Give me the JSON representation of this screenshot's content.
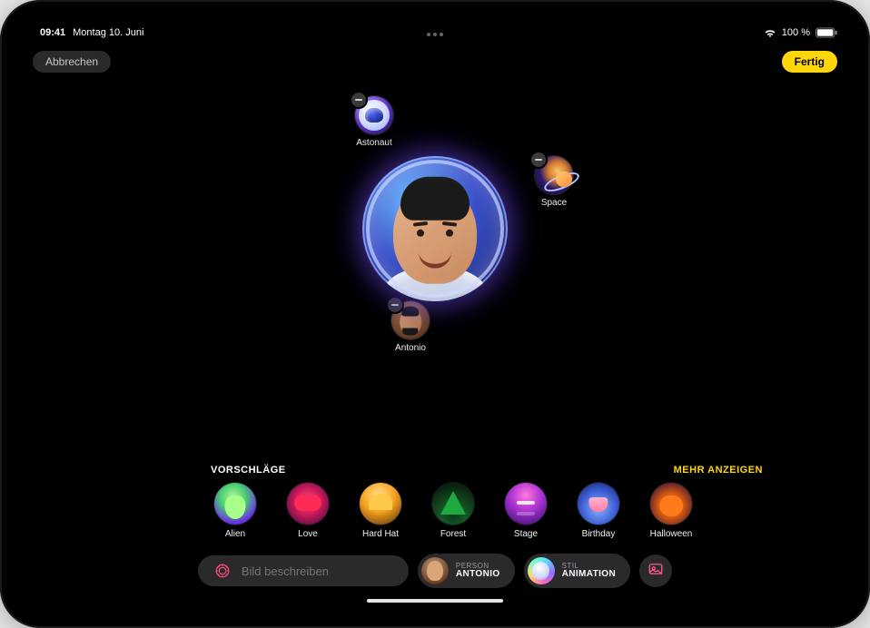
{
  "status": {
    "time": "09:41",
    "date": "Montag 10. Juni",
    "battery_pct": "100 %",
    "wifi_icon": "wifi",
    "battery_icon": "battery-full"
  },
  "nav": {
    "cancel_label": "Abbrechen",
    "done_label": "Fertig"
  },
  "canvas": {
    "preview_alt": "Antonio als Astronaut – Vorschau",
    "orbits": {
      "astronaut": {
        "label": "Astonaut"
      },
      "space": {
        "label": "Space"
      },
      "antonio": {
        "label": "Antonio"
      }
    }
  },
  "suggestions": {
    "header": "VORSCHLÄGE",
    "more": "MEHR ANZEIGEN",
    "items": [
      {
        "id": "alien",
        "label": "Alien"
      },
      {
        "id": "love",
        "label": "Love"
      },
      {
        "id": "hardhat",
        "label": "Hard Hat"
      },
      {
        "id": "forest",
        "label": "Forest"
      },
      {
        "id": "stage",
        "label": "Stage"
      },
      {
        "id": "birthday",
        "label": "Birthday"
      },
      {
        "id": "halloween",
        "label": "Halloween"
      }
    ]
  },
  "input": {
    "describe_placeholder": "Bild beschreiben",
    "person": {
      "caption": "PERSON",
      "value": "ANTONIO"
    },
    "style": {
      "caption": "STIL",
      "value": "ANIMATION"
    }
  },
  "colors": {
    "accent": "#ffd60a",
    "chip_bg": "#2a2a2c"
  }
}
